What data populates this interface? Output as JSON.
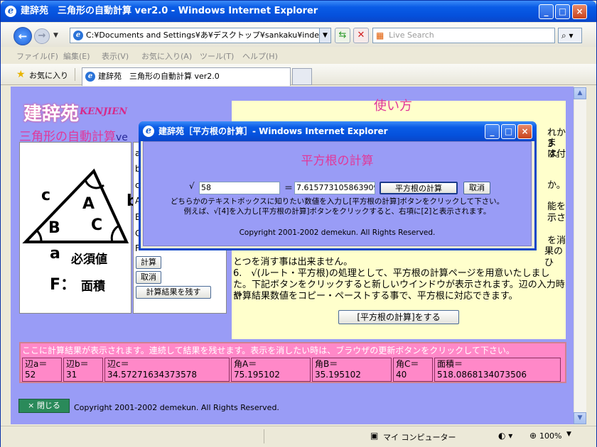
{
  "browser": {
    "title": "建辞苑　三角形の自動計算 ver2.0 - Windows Internet Explorer",
    "address": "C:¥Documents and Settings¥あ¥デスクトップ¥sankaku¥index.htm",
    "search_placeholder": "Live Search",
    "menu": [
      "ファイル(F)",
      "編集(E)",
      "表示(V)",
      "お気に入り(A)",
      "ツール(T)",
      "ヘルプ(H)"
    ],
    "favorites_label": "お気に入り",
    "tab_title": "建辞苑　三角形の自動計算 ver2.0",
    "status_zone": "マイ コンピューター",
    "zoom": "100%"
  },
  "page": {
    "logo": "建辞苑",
    "logo_en": "KENJIEN",
    "subtitle": "三角形の自動計算",
    "subtitle_suffix": "ve",
    "triangle": {
      "label_c": "c",
      "label_b": "b",
      "label_A": "A",
      "label_B": "B",
      "label_C": "C"
    },
    "legend_required": "必須値",
    "legend_a": "a",
    "legend_F": "F：",
    "legend_area": "面積",
    "form_letters": [
      "a",
      "b",
      "c",
      "A",
      "B",
      "C",
      "F"
    ],
    "calc_button": "計算",
    "cancel_button": "取消",
    "keep_button": "計算結果を残す",
    "help": {
      "title": "使い方",
      "right_fragments": [
        "れか3",
        "ます。",
        "は付",
        "か。",
        "能を",
        "示さ",
        "を消",
        "果のひ"
      ],
      "lines": [
        "とつを消す事は出来ません。",
        "6.　√(ルート・平方根)の処理として、平方根の計算ページを用意いたしまし",
        "た。下記ボタンをクリックすると新しいウインドウが表示されます。辺の入力時や",
        "計算結果数値をコピー・ペーストする事で、平方根に対応できます。"
      ],
      "sqrt_page_button": "[平方根の計算]をする"
    },
    "results": {
      "notice": "ここに計算結果が表示されます。連続して結果を残せます。表示を消したい時は、ブラウザの更新ボタンをクリックして下さい。",
      "cells": [
        {
          "label": "辺a＝",
          "value": "52"
        },
        {
          "label": "辺b＝",
          "value": "31"
        },
        {
          "label": "辺c＝",
          "value": "34.57271634373578"
        },
        {
          "label": "角A＝",
          "value": "75.195102"
        },
        {
          "label": "角B＝",
          "value": "35.195102"
        },
        {
          "label": "角C＝",
          "value": "40"
        },
        {
          "label": "面積＝",
          "value": "518.0868134073506"
        }
      ]
    },
    "close_button": "× 閉じる",
    "copyright": "Copyright 2001-2002 demekun. All Rights Reserved."
  },
  "dialog": {
    "title": "建辞苑［平方根の計算］- Windows Internet Explorer",
    "heading": "平方根の計算",
    "sqrt_symbol": "√",
    "input_value": "58",
    "equals": "＝",
    "result_value": "7.615773105863909",
    "calc_button": "平方根の計算",
    "cancel_button": "取消",
    "instruction1": "どちらかのテキストボックスに知りたい数値を入力し[平方根の計算]ボタンをクリックして下さい。",
    "instruction2": "例えば、√[4]を入力し[平方根の計算]ボタンをクリックすると、右項に[2]と表示されます。",
    "copyright": "Copyright 2001-2002 demekun. All Rights Reserved."
  },
  "colors": {
    "page_bg": "#999cf6",
    "help_bg": "#ffffcc",
    "result_bg": "#ff88c8",
    "title_pink": "#e0389a"
  }
}
